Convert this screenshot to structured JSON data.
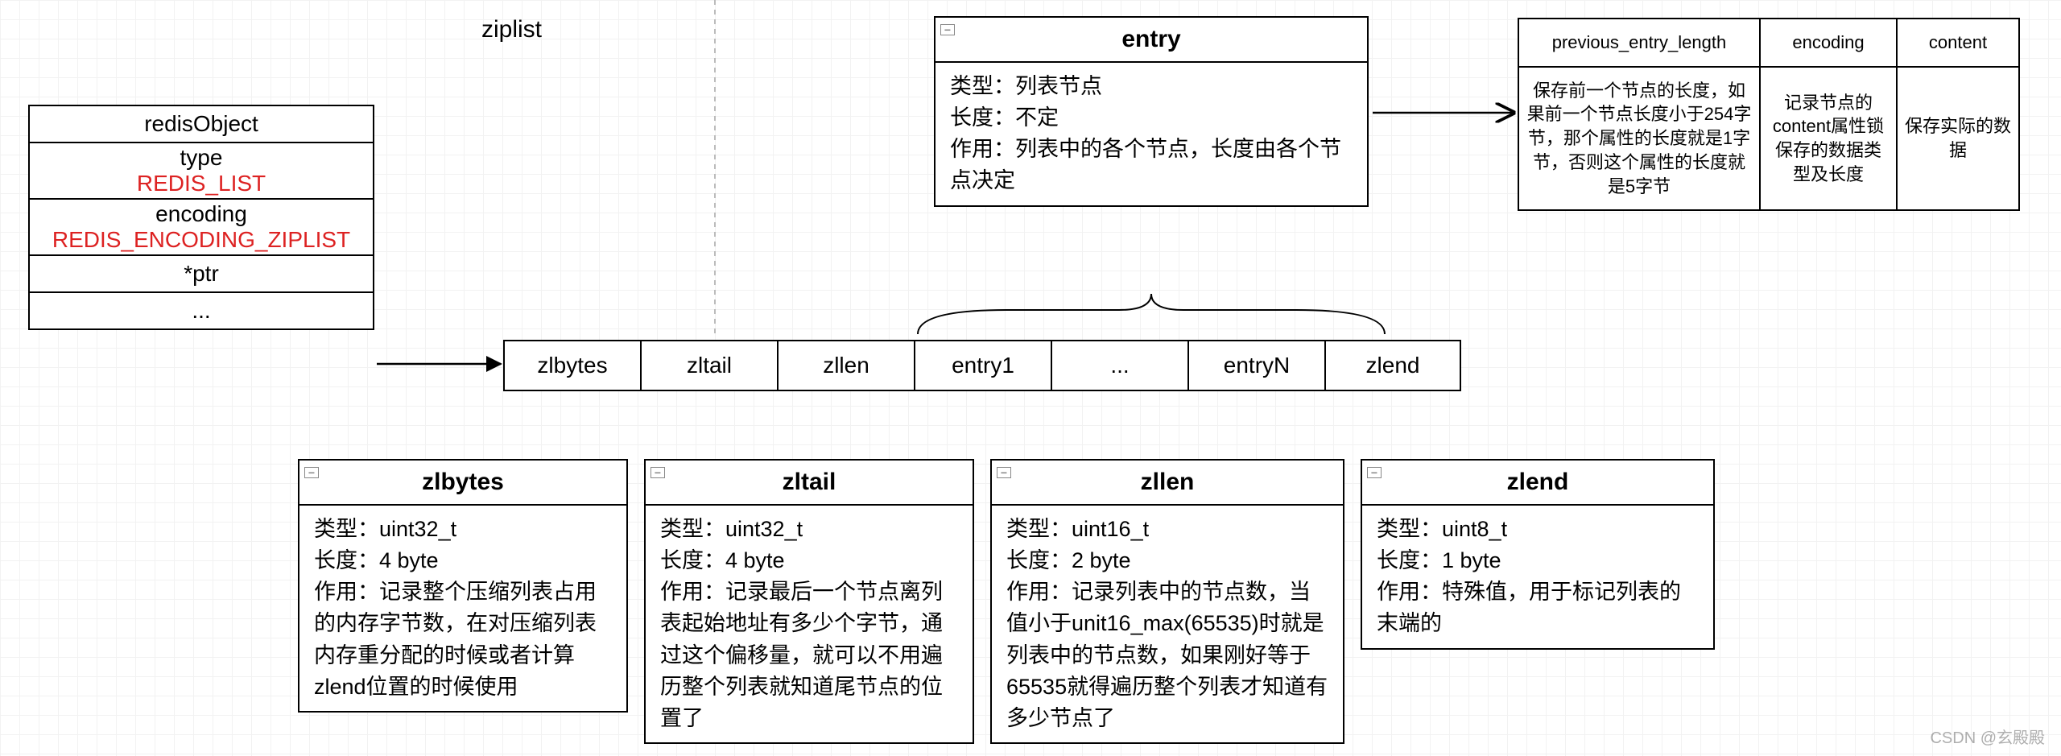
{
  "title": "ziplist",
  "redis": {
    "header": "redisObject",
    "typeLabel": "type",
    "typeValue": "REDIS_LIST",
    "encLabel": "encoding",
    "encValue": "REDIS_ENCODING_ZIPLIST",
    "ptrLabel": "*ptr",
    "dots": "..."
  },
  "zlrow": [
    "zlbytes",
    "zltail",
    "zllen",
    "entry1",
    "...",
    "entryN",
    "zlend"
  ],
  "entryBox": {
    "title": "entry",
    "body": "类型：列表节点\n长度：不定\n作用：列表中的各个节点，长度由各个节点决定"
  },
  "entryTable": {
    "cols": [
      {
        "header": "previous_entry_length",
        "body": "保存前一个节点的长度，如果前一个节点长度小于254字节，那个属性的长度就是1字节，否则这个属性的长度就是5字节"
      },
      {
        "header": "encoding",
        "body": "记录节点的content属性锁保存的数据类型及长度"
      },
      {
        "header": "content",
        "body": "保存实际的数据"
      }
    ]
  },
  "detail": [
    {
      "title": "zlbytes",
      "body": "类型：uint32_t\n长度：4 byte\n作用：记录整个压缩列表占用的内存字节数，在对压缩列表内存重分配的时候或者计算zlend位置的时候使用"
    },
    {
      "title": "zltail",
      "body": "类型：uint32_t\n长度：4 byte\n作用：记录最后一个节点离列表起始地址有多少个字节，通过这个偏移量，就可以不用遍历整个列表就知道尾节点的位置了"
    },
    {
      "title": "zllen",
      "body": "类型：uint16_t\n长度：2 byte\n作用：记录列表中的节点数，当值小于unit16_max(65535)时就是列表中的节点数，如果刚好等于65535就得遍历整个列表才知道有多少节点了"
    },
    {
      "title": "zlend",
      "body": "类型：uint8_t\n长度：1 byte\n作用：特殊值，用于标记列表的末端的"
    }
  ],
  "watermark": "CSDN @玄殿殿"
}
